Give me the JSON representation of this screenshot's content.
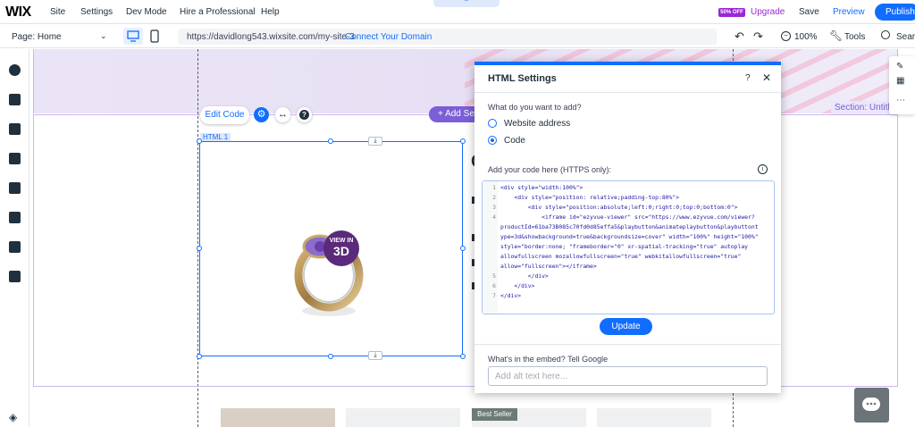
{
  "topbar": {
    "logo": "WIX",
    "menu": [
      "Site",
      "Settings",
      "Dev Mode",
      "Hire a Professional",
      "Help"
    ],
    "sale_badge": "50% OFF",
    "upgrade": "Upgrade",
    "save": "Save",
    "preview": "Preview",
    "publish": "Publish",
    "pull_tab_icon": "chevron-up-icon"
  },
  "toolbar2": {
    "page": "Page: Home",
    "url": "https://davidlong543.wixsite.com/my-site-3",
    "connect": "Connect Your Domain",
    "zoom": "100%",
    "tools": "Tools",
    "search": "Searc"
  },
  "canvas": {
    "section_label": "Section: Untitled",
    "add_section": "Add Se",
    "html_tag": "HTML 1",
    "ring_badge_top": "VIEW IN",
    "ring_badge_big": "3D",
    "best_seller": "Best Seller",
    "peek_letter": "C"
  },
  "element_toolbar": {
    "edit_code": "Edit Code",
    "help": "?"
  },
  "dialog": {
    "title": "HTML Settings",
    "help": "?",
    "close": "✕",
    "question": "What do you want to add?",
    "option_website": "Website address",
    "option_code": "Code",
    "selected_option": "Code",
    "code_label": "Add your code here (HTTPS only):",
    "code_lines": [
      {
        "n": "1",
        "text": "<div style=\"width:100%\">"
      },
      {
        "n": "2",
        "text": "    <div style=\"position: relative;padding-top:80%\">"
      },
      {
        "n": "3",
        "text": "        <div style=\"position:absolute;left:0;right:0;top:0;bottom:0\">"
      },
      {
        "n": "4",
        "text": "            <iframe id=\"ezyvue-viewer\" src=\"https://www.ezyvue.com/viewer?"
      },
      {
        "n": "",
        "text": "productId=61ba73B085c70fd0d85effa5&playbutton&animateplaybutton&playbuttont"
      },
      {
        "n": "",
        "text": "ype=3d&showbackground=true&backgroundsize=cover\" width=\"100%\" height=\"100%\""
      },
      {
        "n": "",
        "text": "style=\"border:none; \"frameborder=\"0\" xr-spatial-tracking=\"true\" autoplay"
      },
      {
        "n": "",
        "text": "allowfullscreen mozallowfullscreen=\"true\" webkitallowfullscreen=\"true\""
      },
      {
        "n": "",
        "text": "allow=\"fullscreen\"></iframe>"
      },
      {
        "n": "5",
        "text": "        </div>"
      },
      {
        "n": "6",
        "text": "    </div>"
      },
      {
        "n": "7",
        "text": "</div>"
      }
    ],
    "update": "Update",
    "embed_label": "What's in the embed? Tell Google",
    "alt_placeholder": "Add alt text here..."
  },
  "colors": {
    "accent": "#116dff",
    "upgrade": "#9a27d5",
    "section": "#7a5fd6"
  }
}
